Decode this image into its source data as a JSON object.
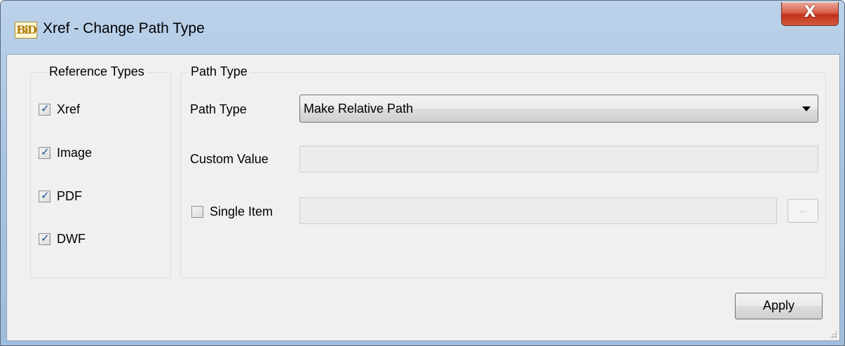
{
  "window": {
    "title": "Xref - Change Path Type",
    "app_icon_text": "BiD",
    "close_glyph": "X"
  },
  "reference_types": {
    "legend": "Reference Types",
    "items": [
      {
        "label": "Xref",
        "checked": true
      },
      {
        "label": "Image",
        "checked": true
      },
      {
        "label": "PDF",
        "checked": true
      },
      {
        "label": "DWF",
        "checked": true
      }
    ]
  },
  "path_type_group": {
    "legend": "Path Type",
    "path_type_label": "Path Type",
    "path_type_value": "Make Relative Path",
    "custom_value_label": "Custom Value",
    "custom_value": "",
    "single_item_label": "Single Item",
    "single_item_checked": false,
    "single_item_value": "",
    "browse_label": "..."
  },
  "footer": {
    "apply_label": "Apply"
  }
}
